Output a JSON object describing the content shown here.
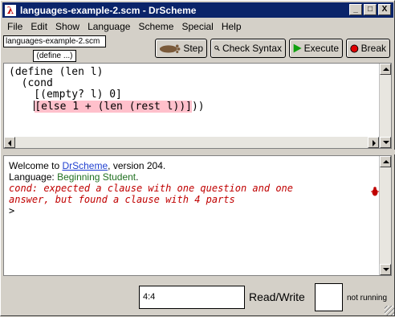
{
  "window": {
    "title": "languages-example-2.scm - DrScheme",
    "app_icon": "λ",
    "controls": {
      "minimize": "_",
      "maximize": "□",
      "close": "X"
    }
  },
  "menu": [
    "File",
    "Edit",
    "Show",
    "Language",
    "Scheme",
    "Special",
    "Help"
  ],
  "toolbar": {
    "file_name": "languages-example-2.scm",
    "define_menu": "(define ...)",
    "step_label": "Step",
    "check_syntax_label": "Check Syntax",
    "execute_label": "Execute",
    "break_label": "Break"
  },
  "definitions": {
    "lines": [
      "(define (len l)",
      "  (cond",
      "    [(empty? l) 0]"
    ],
    "highlighted_line_prefix": "    ",
    "highlighted_text": "[else 1 + (len (rest l))]",
    "highlighted_line_suffix": "))"
  },
  "interactions": {
    "welcome_prefix": "Welcome to ",
    "welcome_link": "DrScheme",
    "welcome_suffix": ", version 204.",
    "language_prefix": "Language: ",
    "language_name": "Beginning Student",
    "language_suffix": ".",
    "error_lines": [
      "cond: expected a clause with one question and one",
      "answer, but found a clause with 4 parts"
    ],
    "prompt": ">"
  },
  "status": {
    "position": "4:4",
    "mode": "Read/Write",
    "running_state": "not running"
  },
  "colors": {
    "titlebar": "#0a246a",
    "highlight": "#ffc0cb",
    "error": "#c00000",
    "link": "#2040d0",
    "language": "#207020",
    "execute_icon": "#10a010",
    "break_icon": "#e00000"
  }
}
